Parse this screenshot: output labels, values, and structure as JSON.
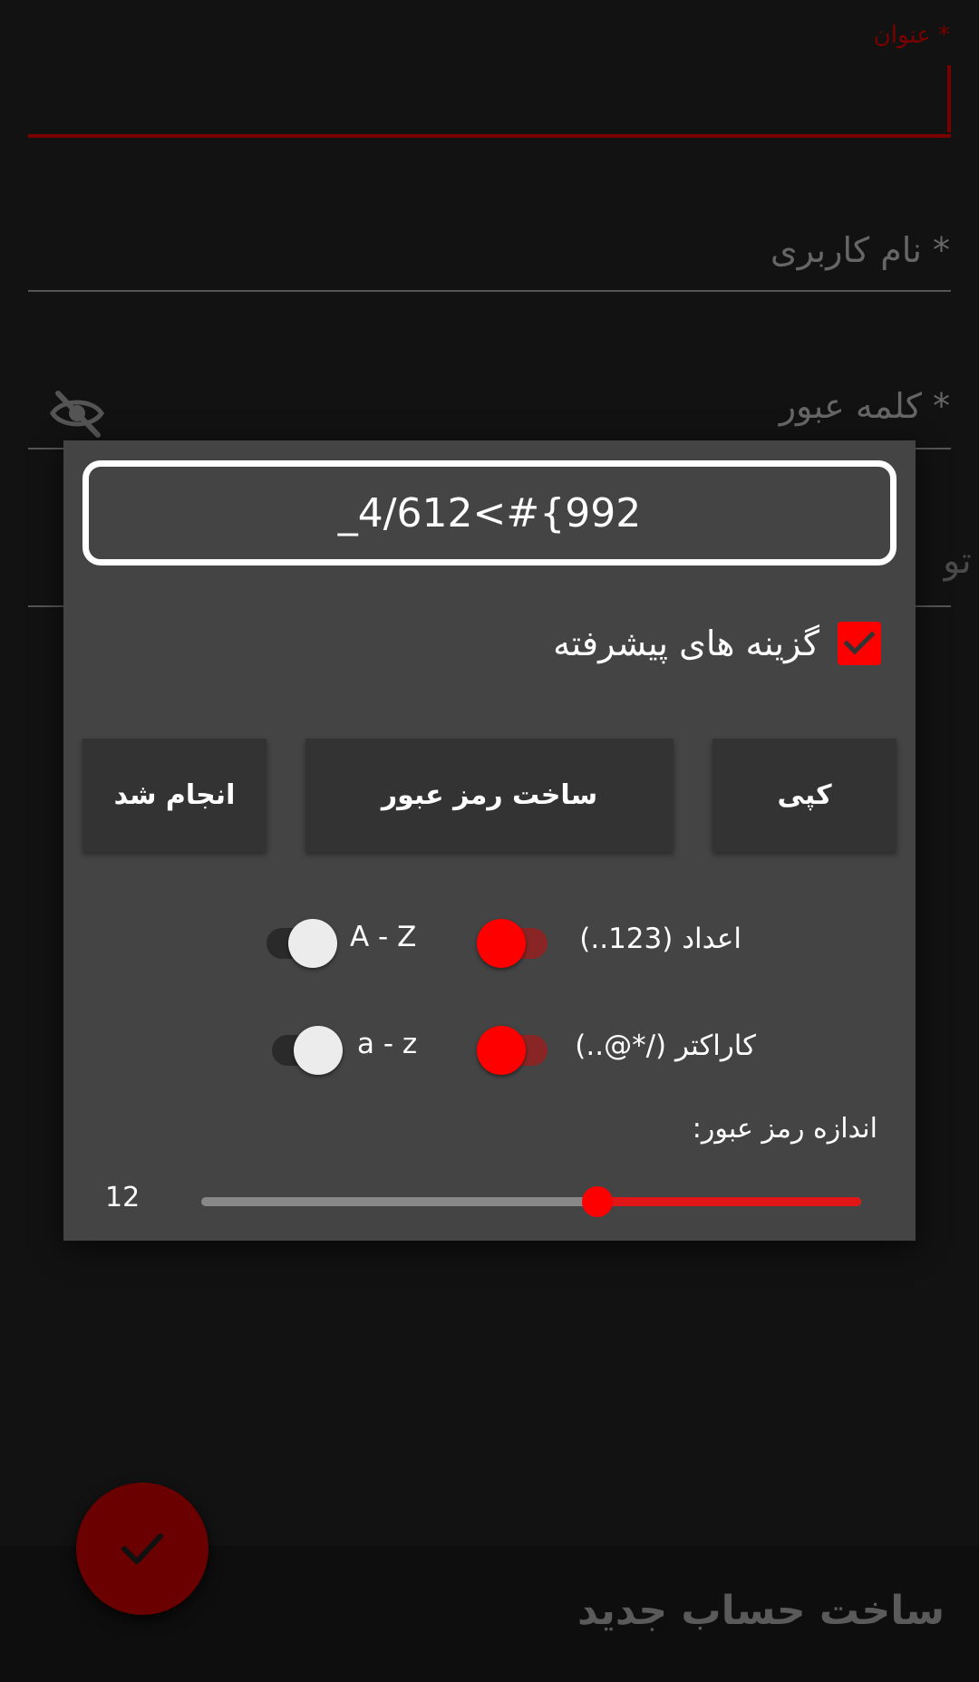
{
  "form": {
    "title_label": "* عنوان",
    "username_placeholder": "* نام کاربری",
    "password_placeholder": "* کلمه عبور",
    "description_hint": "تو"
  },
  "dialog": {
    "generated_password": "_4/612<#{992",
    "advanced_options_label": "گزینه های پیشرفته",
    "advanced_options_checked": true,
    "buttons": {
      "done": "انجام شد",
      "generate": "ساخت رمز عبور",
      "copy": "کپی"
    },
    "options": {
      "numbers_label": "اعداد (123..)",
      "numbers_on": true,
      "uppercase_label": "A - Z",
      "uppercase_on": false,
      "symbols_label": "کاراکتر (/*@..)",
      "symbols_on": true,
      "lowercase_label": "a - z",
      "lowercase_on": false
    },
    "length_label": "اندازه رمز عبور:",
    "length_value": "12",
    "length_slider_fraction": 0.6
  },
  "footer": {
    "title": "ساخت حساب جدید"
  },
  "colors": {
    "accent": "#ff0000",
    "dialog_bg": "#444444",
    "button_bg": "#333333"
  }
}
